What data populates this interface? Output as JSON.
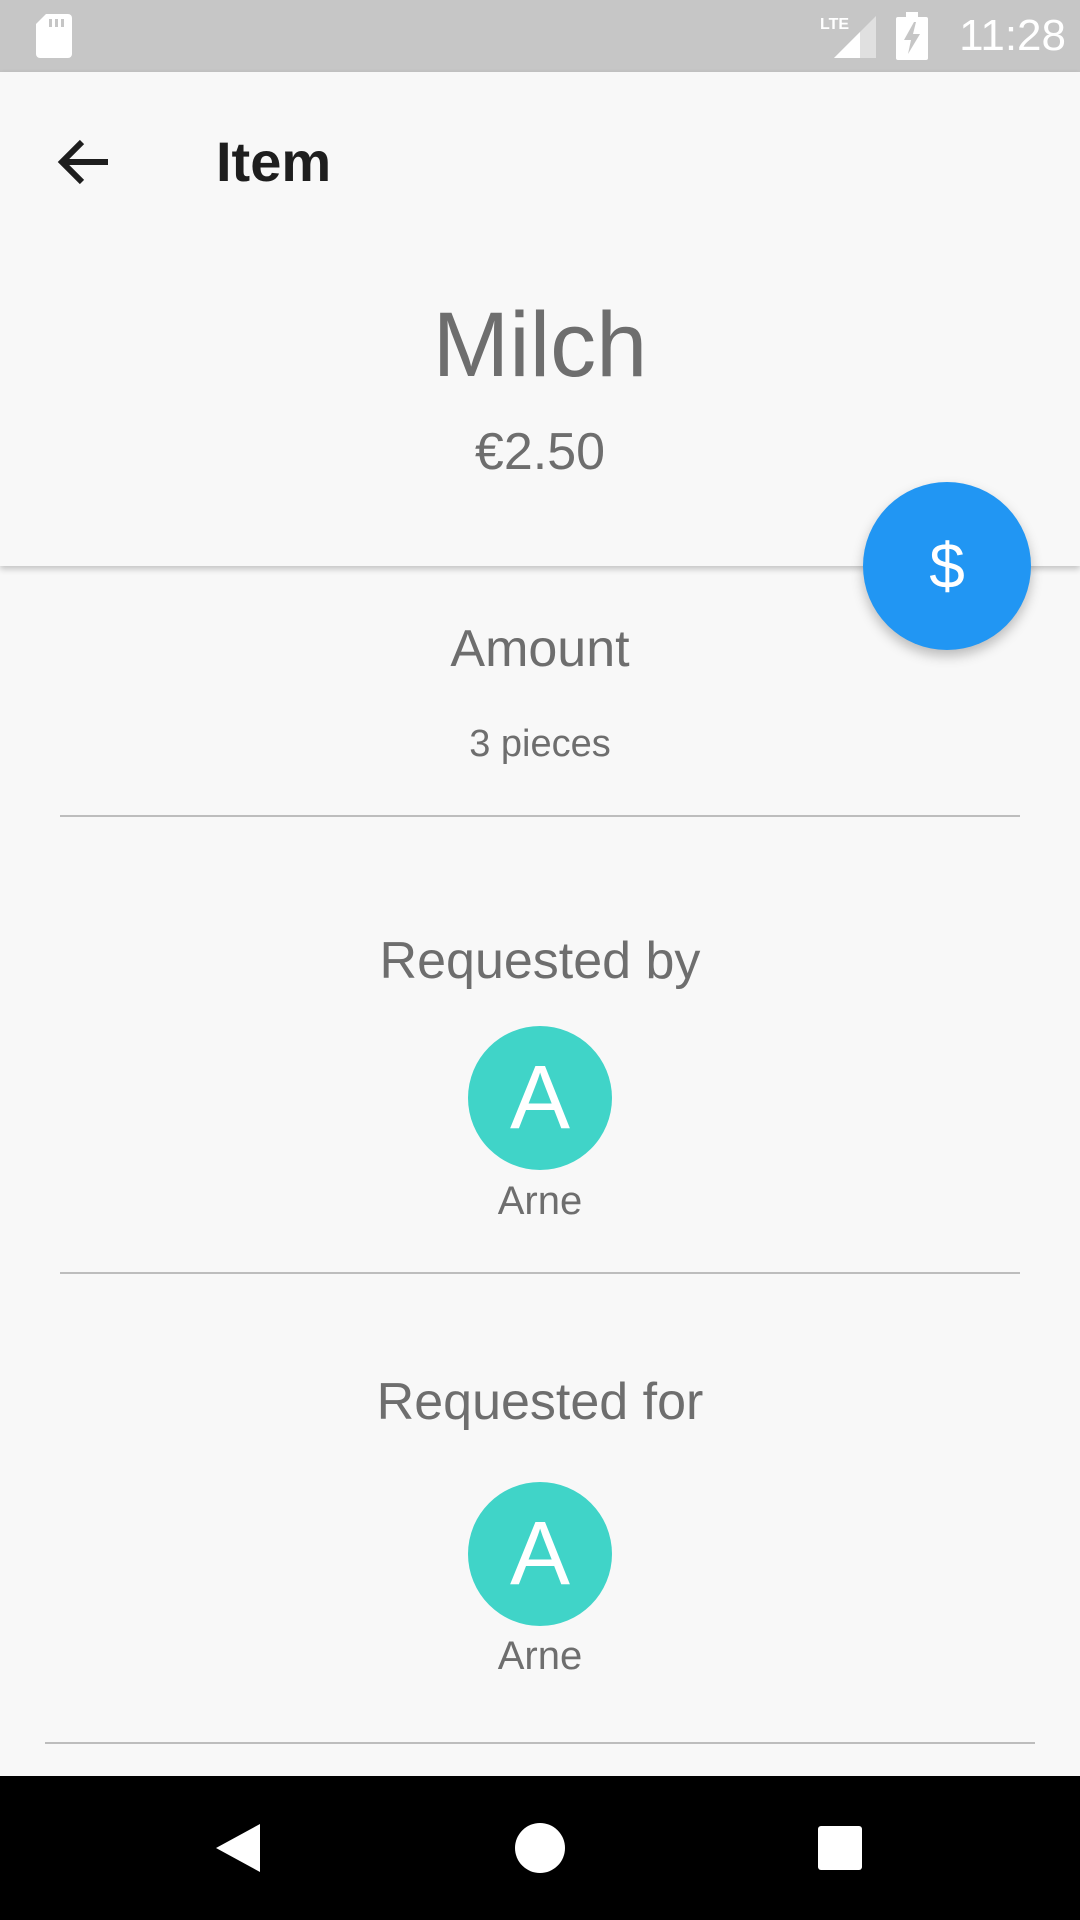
{
  "status_bar": {
    "time": "11:28",
    "icons": [
      "sd-card-icon",
      "lte-signal-icon",
      "battery-charging-icon"
    ]
  },
  "toolbar": {
    "back_icon": "arrow-back-icon",
    "title": "Item"
  },
  "item": {
    "name": "Milch",
    "price": "€2.50"
  },
  "fab": {
    "label": "$",
    "icon": "dollar-icon"
  },
  "amount": {
    "title": "Amount",
    "value": "3 pieces"
  },
  "requested_by": {
    "title": "Requested by",
    "avatar_letter": "A",
    "name": "Arne"
  },
  "requested_for": {
    "title": "Requested for",
    "avatar_letter": "A",
    "name": "Arne"
  },
  "nav_bar": {
    "buttons": [
      "nav-back-icon",
      "nav-home-icon",
      "nav-recents-icon"
    ]
  },
  "colors": {
    "fab": "#2196f3",
    "avatar": "#40d4c8",
    "status_bar": "#c6c6c6",
    "text": "#6e6e6e"
  }
}
